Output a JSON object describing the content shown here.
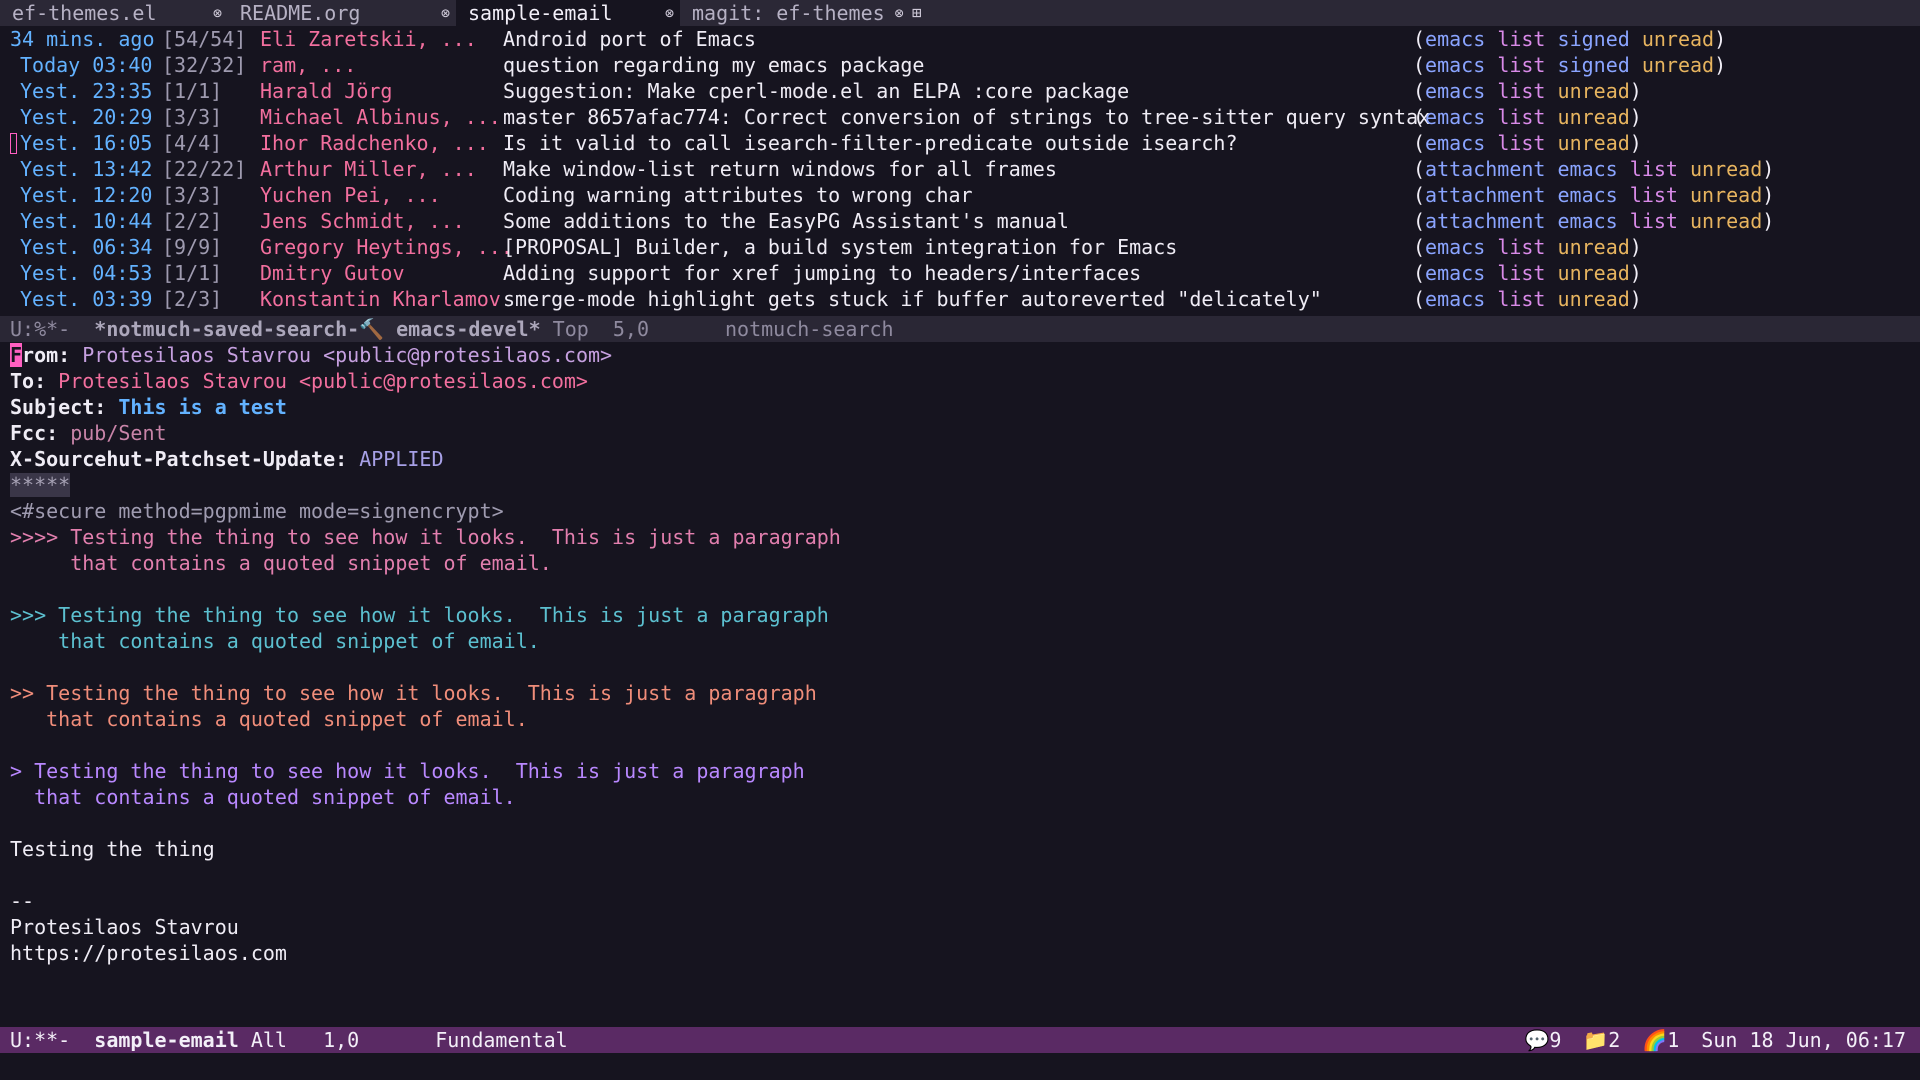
{
  "tabs": [
    {
      "label": "ef-themes.el",
      "close": "⊗",
      "active": false
    },
    {
      "label": "README.org",
      "close": "⊗",
      "active": false
    },
    {
      "label": "sample-email",
      "close": "⊗",
      "active": true
    },
    {
      "label": "magit: ef-themes",
      "close": "⊗",
      "active": false
    }
  ],
  "tab_new": "⊞",
  "search_rows": [
    {
      "date": "34 mins. ago",
      "count": "[54/54]",
      "authors": "Eli Zaretskii, ...",
      "subject": "Android port of Emacs",
      "tags": [
        "emacs",
        "list",
        "signed",
        "unread"
      ]
    },
    {
      "date": "Today 03:40",
      "count": "[32/32]",
      "authors": "ram, ...",
      "subject": "question regarding my emacs package",
      "tags": [
        "emacs",
        "list",
        "signed",
        "unread"
      ]
    },
    {
      "date": "Yest. 23:35",
      "count": "[1/1]",
      "authors": "Harald Jörg",
      "subject": "Suggestion: Make cperl-mode.el an ELPA :core package",
      "tags": [
        "emacs",
        "list",
        "unread"
      ]
    },
    {
      "date": "Yest. 20:29",
      "count": "[3/3]",
      "authors": "Michael Albinus, ...",
      "subject": "master 8657afac774: Correct conversion of strings to tree-sitter query syntax",
      "tags": [
        "emacs",
        "list",
        "unread"
      ]
    },
    {
      "date": "Yest. 16:05",
      "count": "[4/4]",
      "authors": "Ihor Radchenko, ...",
      "subject": "Is it valid to call isearch-filter-predicate outside isearch?",
      "tags": [
        "emacs",
        "list",
        "unread"
      ]
    },
    {
      "date": "Yest. 13:42",
      "count": "[22/22]",
      "authors": "Arthur Miller, ...",
      "subject": "Make window-list return windows for all frames",
      "tags": [
        "attachment",
        "emacs",
        "list",
        "unread"
      ]
    },
    {
      "date": "Yest. 12:20",
      "count": "[3/3]",
      "authors": "Yuchen Pei, ...",
      "subject": "Coding warning attributes to wrong char",
      "tags": [
        "attachment",
        "emacs",
        "list",
        "unread"
      ]
    },
    {
      "date": "Yest. 10:44",
      "count": "[2/2]",
      "authors": "Jens Schmidt, ...",
      "subject": "Some additions to the EasyPG Assistant's manual",
      "tags": [
        "attachment",
        "emacs",
        "list",
        "unread"
      ]
    },
    {
      "date": "Yest. 06:34",
      "count": "[9/9]",
      "authors": "Gregory Heytings, ...",
      "subject": "[PROPOSAL] Builder, a build system integration for Emacs",
      "tags": [
        "emacs",
        "list",
        "unread"
      ]
    },
    {
      "date": "Yest. 04:53",
      "count": "[1/1]",
      "authors": "Dmitry Gutov",
      "subject": "Adding support for xref jumping to headers/interfaces",
      "tags": [
        "emacs",
        "list",
        "unread"
      ]
    },
    {
      "date": "Yest. 03:39",
      "count": "[2/3]",
      "authors": "Konstantin Kharlamov",
      "subject": "smerge-mode highlight gets stuck if buffer autoreverted \"delicately\"",
      "tags": [
        "emacs",
        "list",
        "unread"
      ]
    }
  ],
  "modeline_top": {
    "state": "U:%*-  ",
    "buffer": "*notmuch-saved-search-🔨 emacs-devel*",
    "position": " Top  5,0",
    "mode": "notmuch-search"
  },
  "email": {
    "from_label": "From:",
    "from_cursor": "F",
    "from_rest": "rom:",
    "from_value": "Protesilaos Stavrou <public@protesilaos.com>",
    "to_label": "To:",
    "to_value": "Protesilaos Stavrou <public@protesilaos.com>",
    "subject_label": "Subject:",
    "subject_value": "This is a test",
    "fcc_label": "Fcc:",
    "fcc_value": "pub/Sent",
    "xs_label": "X-Sourcehut-Patchset-Update:",
    "xs_value": "APPLIED",
    "separator": "*****",
    "secure": "<#secure method=pgpmime mode=signencrypt>",
    "q4_a": ">>>> Testing the thing to see how it looks.  This is just a paragraph",
    "q4_b": "     that contains a quoted snippet of email.",
    "q3_a": ">>> Testing the thing to see how it looks.  This is just a paragraph",
    "q3_b": "    that contains a quoted snippet of email.",
    "q2_a": ">> Testing the thing to see how it looks.  This is just a paragraph",
    "q2_b": "   that contains a quoted snippet of email.",
    "q1_a": "> Testing the thing to see how it looks.  This is just a paragraph",
    "q1_b": "  that contains a quoted snippet of email.",
    "body": "Testing the thing",
    "sig_sep": "--",
    "sig_name": "Protesilaos Stavrou",
    "sig_url": "https://protesilaos.com"
  },
  "modeline_bottom": {
    "state": "U:**-  ",
    "buffer": "sample-email",
    "position": " All   1,0",
    "mode": "Fundamental",
    "chat": "💬9",
    "folder": "📁2",
    "rainbow": "🌈1",
    "datetime": "Sun 18 Jun, 06:17"
  },
  "colors": {
    "background": "#16141f",
    "modeline_active": "#5a2a64",
    "cursor": "#ff5fc1"
  }
}
